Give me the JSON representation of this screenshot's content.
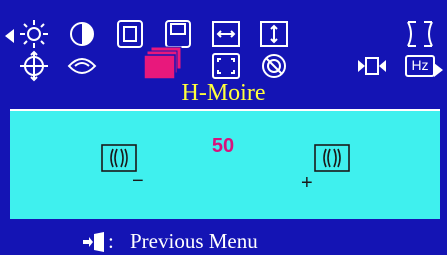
{
  "menu": {
    "title": "H-Moire",
    "row1": [
      "brightness-icon",
      "contrast-icon",
      "size-icon",
      "position-icon",
      "h-size-icon",
      "v-size-icon",
      "pincushion-icon"
    ],
    "row2": [
      "position-rotate-icon",
      "moire-icon",
      "h-moire-icon",
      "v-moire-icon",
      "degauss-icon",
      "input-icon",
      "frequency-icon"
    ],
    "selected": "h-moire-icon",
    "frequency_label": "Hz"
  },
  "adjustment": {
    "value": "50",
    "minus_label": "−",
    "plus_label": "+"
  },
  "footer": {
    "separator": ":",
    "label": "Previous Menu"
  },
  "colors": {
    "background": "#1414b4",
    "panel": "#3ff0ee",
    "selected_icon": "#e8187c",
    "title": "#ffff3c",
    "value": "#d8127c"
  }
}
